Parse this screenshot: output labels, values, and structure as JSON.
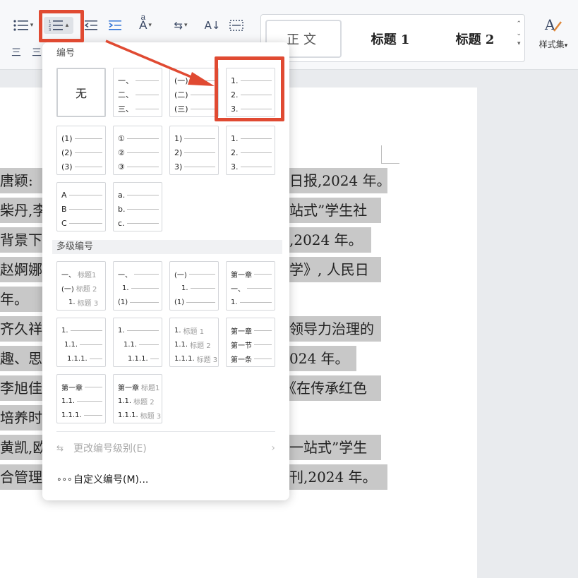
{
  "ribbon": {
    "styles": {
      "normal": "正文",
      "heading1": "标题  1",
      "heading2": "标题  2"
    },
    "styleset_label": "样式集",
    "bottom_row": {
      "align_left_icon": "三",
      "align_center_icon": "三"
    }
  },
  "numbering_menu": {
    "section_numbering": "编号",
    "none_label": "无",
    "section_multilevel": "多级编号",
    "single_level": [
      {
        "lines": []
      },
      {
        "lines": [
          "一、",
          "二、",
          "三、"
        ]
      },
      {
        "lines": [
          "(一)",
          "(二)",
          "(三)"
        ]
      },
      {
        "lines": [
          "1.",
          "2.",
          "3."
        ]
      },
      {
        "lines": [
          "(1)",
          "(2)",
          "(3)"
        ]
      },
      {
        "lines": [
          "①",
          "②",
          "③"
        ]
      },
      {
        "lines": [
          "1)",
          "2)",
          "3)"
        ]
      },
      {
        "lines": [
          "1.",
          "2.",
          "3."
        ]
      },
      {
        "lines": [
          "A",
          "B",
          "C"
        ]
      },
      {
        "lines": [
          "a.",
          "b.",
          "c."
        ]
      }
    ],
    "multi_level": [
      {
        "lines": [
          [
            "一、",
            "标题1"
          ],
          [
            "(一)",
            "标题 2"
          ],
          [
            "1.",
            "标题 3"
          ]
        ]
      },
      {
        "lines": [
          [
            "一、",
            ""
          ],
          [
            "1.",
            ""
          ],
          [
            "(1)",
            ""
          ]
        ]
      },
      {
        "lines": [
          [
            "(一)",
            ""
          ],
          [
            "1.",
            ""
          ],
          [
            "(1)",
            ""
          ]
        ]
      },
      {
        "lines": [
          [
            "第一章",
            ""
          ],
          [
            "一、",
            ""
          ],
          [
            "1.",
            ""
          ]
        ]
      },
      {
        "lines": [
          [
            "1.",
            ""
          ],
          [
            "1.1.",
            ""
          ],
          [
            "1.1.1.",
            ""
          ]
        ]
      },
      {
        "lines": [
          [
            "1.",
            ""
          ],
          [
            "1.1.",
            ""
          ],
          [
            "1.1.1.",
            ""
          ]
        ]
      },
      {
        "lines": [
          [
            "1.",
            "标题 1"
          ],
          [
            "1.1.",
            "标题 2"
          ],
          [
            "1.1.1.",
            "标题 3"
          ]
        ]
      },
      {
        "lines": [
          [
            "第一章",
            ""
          ],
          [
            "第一节",
            ""
          ],
          [
            "第一条",
            ""
          ]
        ]
      },
      {
        "lines": [
          [
            "第一章",
            ""
          ],
          [
            "1.1.",
            ""
          ],
          [
            "1.1.1.",
            ""
          ]
        ]
      },
      {
        "lines": [
          [
            "第一章",
            "标题1"
          ],
          [
            "1.1.",
            "标题 2"
          ],
          [
            "1.1.1.",
            "标题 3"
          ]
        ]
      }
    ],
    "change_level": "更改编号级别(E)",
    "custom_numbering": "自定义编号(M)..."
  },
  "document": {
    "lines": [
      {
        "left": "唐颖:",
        "right": "日报,2024 年。"
      },
      {
        "left": "柴丹,李",
        "right": "站式”学生社"
      },
      {
        "left": "背景下",
        "right": ",2024 年。"
      },
      {
        "left": "赵婀娜",
        "right": "学》, 人民日"
      },
      {
        "left": "年。",
        "right": ""
      },
      {
        "left": "齐久祥",
        "right": "领导力治理的"
      },
      {
        "left": "趣、思",
        "right": "024 年。"
      },
      {
        "left": "李旭佳",
        "right": "《在传承红色"
      },
      {
        "left": "培养时",
        "right": ""
      },
      {
        "left": "黄凯,欧",
        "right": "一站式”学生"
      },
      {
        "left": "合管理",
        "right": "刊,2024 年。"
      }
    ]
  },
  "colors": {
    "highlight": "#e04a32",
    "selection": "#c8c8c8"
  }
}
